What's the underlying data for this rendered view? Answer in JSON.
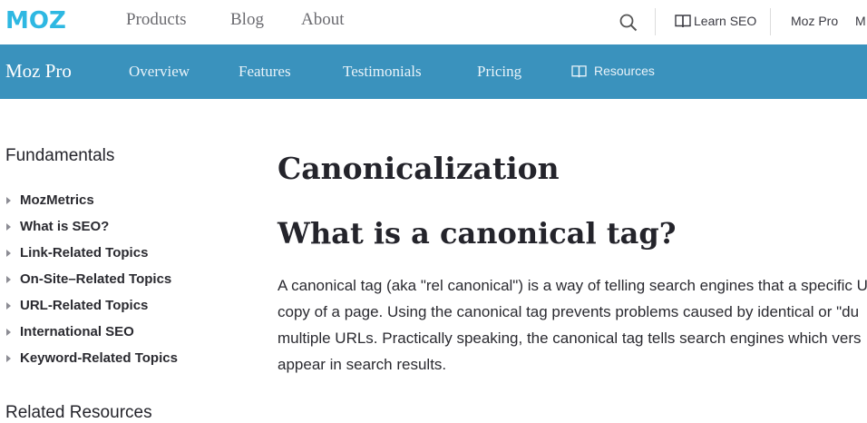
{
  "topbar": {
    "logo": "MOZ",
    "nav": [
      "Products",
      "Blog",
      "About"
    ],
    "learn_seo": "Learn SEO",
    "moz_pro": "Moz Pro",
    "cut_item": "M"
  },
  "subnav": {
    "title": "Moz Pro",
    "items": [
      "Overview",
      "Features",
      "Testimonials",
      "Pricing"
    ],
    "resources": "Resources"
  },
  "sidebar": {
    "heading": "Fundamentals",
    "items": [
      "MozMetrics",
      "What is SEO?",
      "Link-Related Topics",
      "On-Site–Related Topics",
      "URL-Related Topics",
      "International SEO",
      "Keyword-Related Topics"
    ],
    "related_heading": "Related Resources"
  },
  "main": {
    "title": "Canonicalization",
    "subtitle": "What is a canonical tag?",
    "paragraph_lines": [
      "A canonical tag (aka \"rel canonical\") is a way of telling search engines that a specific U",
      "copy of a page. Using the canonical tag prevents problems caused by identical or \"du",
      "multiple URLs. Practically speaking, the canonical tag tells search engines which vers",
      "appear in search results."
    ]
  },
  "colors": {
    "brand": "#3a92bd",
    "logo": "#2eb8e2",
    "text": "#24242b"
  },
  "icons": [
    "search-icon",
    "book-icon"
  ]
}
